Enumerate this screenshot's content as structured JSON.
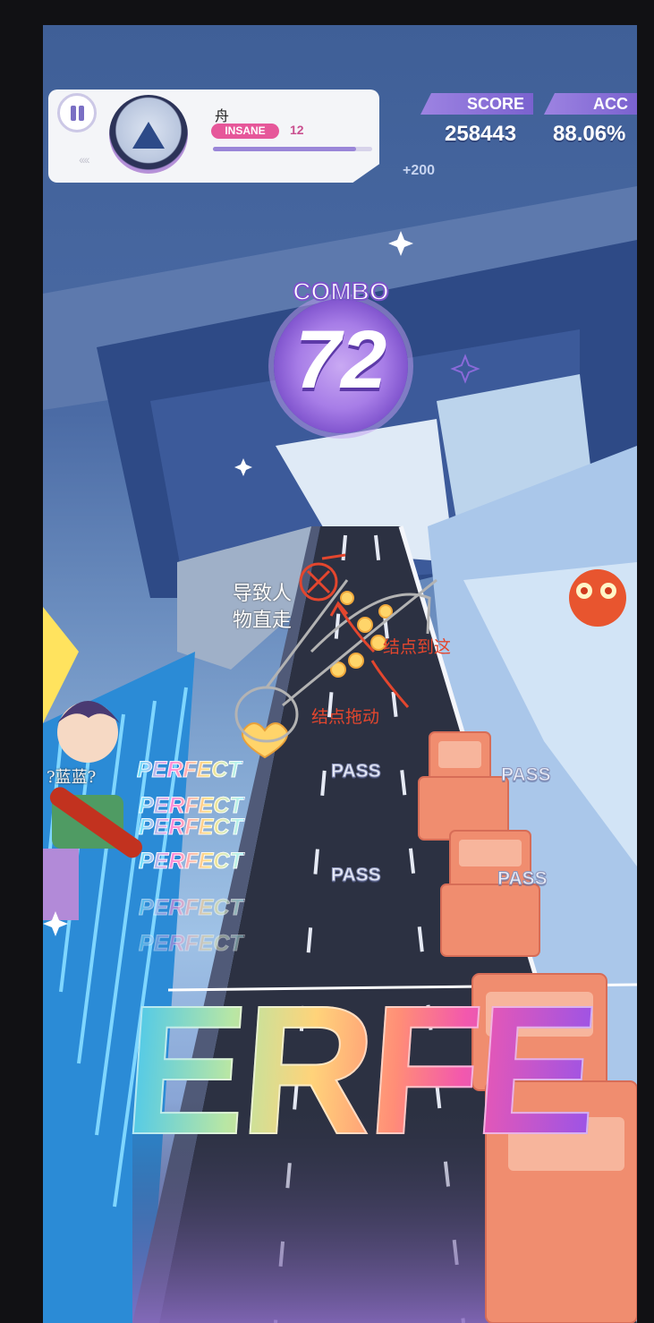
{
  "hud": {
    "song_title": "舟",
    "difficulty": "INSANE",
    "level": "12",
    "progress_fraction": 0.9,
    "score_label": "SCORE",
    "score_value": "258443",
    "acc_label": "ACC",
    "acc_value": "88.06%",
    "bonus": "+200"
  },
  "combo": {
    "label": "COMBO",
    "value": "72"
  },
  "judgements": {
    "perfect": "PERFECT",
    "pass": "PASS",
    "big_text": "ERFE"
  },
  "annotations": {
    "left_note_line1": "导致人",
    "left_note_line2": "物直走",
    "right_note_top": "结点到这",
    "right_note_bottom": "结点拖动",
    "character_note": "?蓝蓝?"
  },
  "colors": {
    "accent_purple": "#8a6ad9",
    "difficulty_pink": "#e6579a",
    "annotation_red": "#e3462e",
    "annotation_gray": "#b3b3b3"
  }
}
